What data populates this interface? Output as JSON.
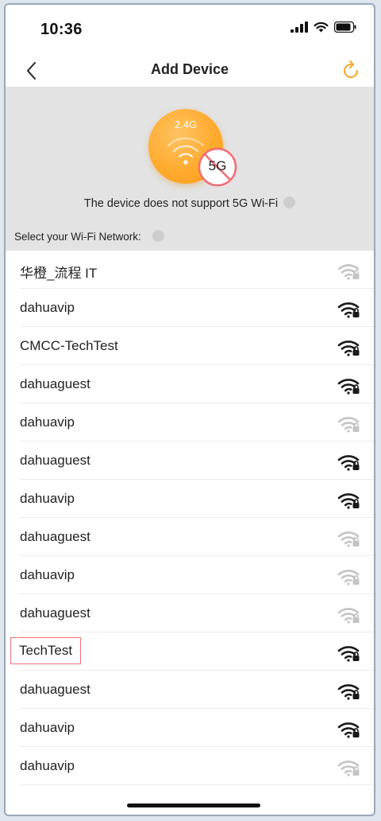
{
  "status": {
    "time": "10:36"
  },
  "nav": {
    "title": "Add Device"
  },
  "hero": {
    "band_label": "2.4G",
    "no5g_label": "5G",
    "notice": "The device does not support 5G Wi-Fi",
    "select_label": "Select your Wi-Fi Network:"
  },
  "networks": [
    {
      "ssid": "华橙_流程 IT",
      "signal": "weak"
    },
    {
      "ssid": "dahuavip",
      "signal": "strong"
    },
    {
      "ssid": "CMCC-TechTest",
      "signal": "strong"
    },
    {
      "ssid": "dahuaguest",
      "signal": "strong"
    },
    {
      "ssid": "dahuavip",
      "signal": "weak"
    },
    {
      "ssid": "dahuaguest",
      "signal": "strong"
    },
    {
      "ssid": "dahuavip",
      "signal": "strong"
    },
    {
      "ssid": "dahuaguest",
      "signal": "weak"
    },
    {
      "ssid": "dahuavip",
      "signal": "weak"
    },
    {
      "ssid": "dahuaguest",
      "signal": "weak"
    },
    {
      "ssid": "TechTest",
      "signal": "strong",
      "highlighted": true
    },
    {
      "ssid": "dahuaguest",
      "signal": "strong"
    },
    {
      "ssid": "dahuavip",
      "signal": "strong"
    },
    {
      "ssid": "dahuavip",
      "signal": "weak"
    }
  ],
  "colors": {
    "accent": "#f5a623",
    "strong": "#1a1a1a",
    "weak": "#c4c4c4",
    "highlight": "#f2707a"
  },
  "icons": {
    "back": "chevron-left-icon",
    "refresh": "refresh-icon",
    "wifi": "wifi-lock-icon"
  }
}
